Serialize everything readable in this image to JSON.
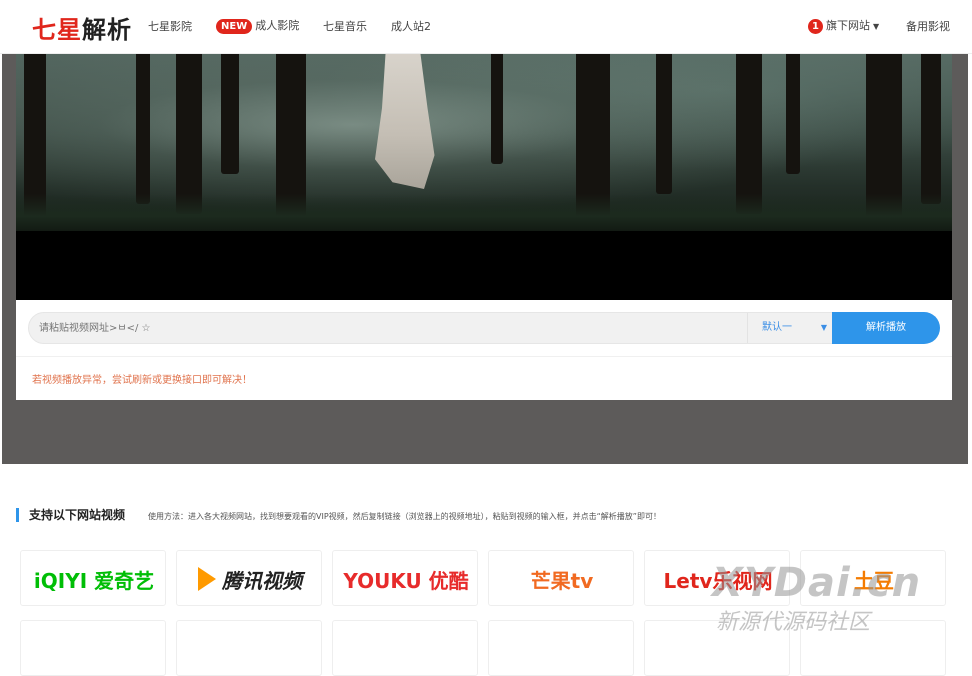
{
  "nav": {
    "logo_part1": "七星",
    "logo_part2": "解析",
    "links": [
      "七星影院",
      "成人影院",
      "七星音乐",
      "成人站2"
    ],
    "new_badge": "NEW",
    "right_badge": "1",
    "right_link": "旗下网站",
    "right_link2": "备用影视"
  },
  "player": {
    "url_placeholder": "请粘贴视频网址>ㅂ</ ☆",
    "select_value": "默认一",
    "parse_button": "解析播放",
    "tip": "若视频播放异常，尝试刷新或更换接口即可解决！"
  },
  "section": {
    "title": "支持以下网站视频",
    "desc": "使用方法：进入各大视频网站，找到想要观看的VIP视频，然后复制链接（浏览器上的视频地址），粘贴到视频的输入框，并点击“解析播放”即可！"
  },
  "sites": [
    {
      "name": "iQIYI 爱奇艺",
      "color": "#00be06"
    },
    {
      "name": "腾讯视频",
      "color": "#222222"
    },
    {
      "name": "YOUKU 优酷",
      "color": "#e72b2b"
    },
    {
      "name": "芒果tv",
      "color": "#f16a21"
    },
    {
      "name": "Letv乐视网",
      "color": "#e0261c"
    },
    {
      "name": "土豆",
      "color": "#f47b00"
    }
  ],
  "watermark": {
    "line1": "XYDai.cn",
    "line2": "新源代源码社区"
  },
  "colors": {
    "brand_red": "#e0261c",
    "accent_blue": "#2e95ea"
  }
}
